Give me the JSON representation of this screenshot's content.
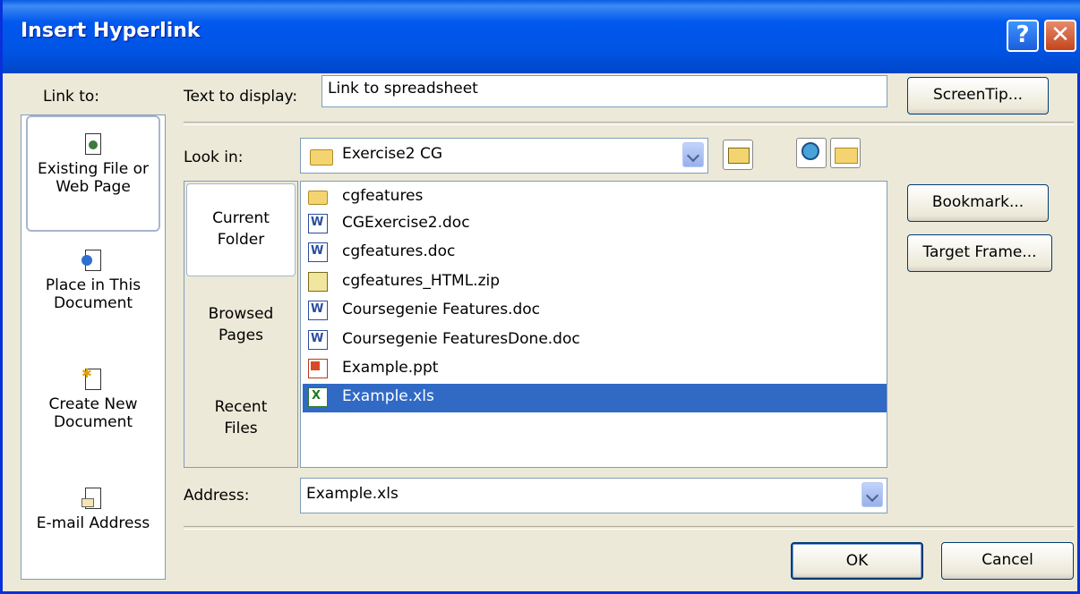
{
  "window": {
    "title": "Insert Hyperlink",
    "help_glyph": "?",
    "close_glyph": "✕"
  },
  "link_to": {
    "label": "Link to:",
    "items": [
      {
        "line1": "Existing File or",
        "line2": "Web Page",
        "icon": "existing-file-icon",
        "selected": true
      },
      {
        "line1": "Place in This",
        "line2": "Document",
        "icon": "place-in-document-icon",
        "selected": false
      },
      {
        "line1": "Create New",
        "line2": "Document",
        "icon": "create-new-document-icon",
        "selected": false
      },
      {
        "line1": "E-mail Address",
        "line2": "",
        "icon": "email-address-icon",
        "selected": false
      }
    ]
  },
  "text_to_display": {
    "label": "Text to display:",
    "value": "Link to spreadsheet"
  },
  "look_in": {
    "label": "Look in:",
    "value": "Exercise2 CG"
  },
  "places": [
    {
      "line1": "Current",
      "line2": "Folder",
      "selected": true
    },
    {
      "line1": "Browsed",
      "line2": "Pages",
      "selected": false
    },
    {
      "line1": "Recent",
      "line2": "Files",
      "selected": false
    }
  ],
  "files": [
    {
      "name": "cgfeatures",
      "type": "folder"
    },
    {
      "name": "CGExercise2.doc",
      "type": "word"
    },
    {
      "name": "cgfeatures.doc",
      "type": "word"
    },
    {
      "name": "cgfeatures_HTML.zip",
      "type": "zip"
    },
    {
      "name": "Coursegenie Features.doc",
      "type": "word"
    },
    {
      "name": "Coursegenie FeaturesDone.doc",
      "type": "word"
    },
    {
      "name": "Example.ppt",
      "type": "ppt"
    },
    {
      "name": "Example.xls",
      "type": "xls",
      "selected": true
    }
  ],
  "address": {
    "label": "Address:",
    "value": "Example.xls"
  },
  "buttons": {
    "screentip": "ScreenTip...",
    "bookmark": "Bookmark...",
    "target_frame": "Target Frame...",
    "ok": "OK",
    "cancel": "Cancel"
  },
  "colors": {
    "title_bar": "#0054e3",
    "selection": "#316ac5",
    "dialog_bg": "#ece9d8"
  }
}
